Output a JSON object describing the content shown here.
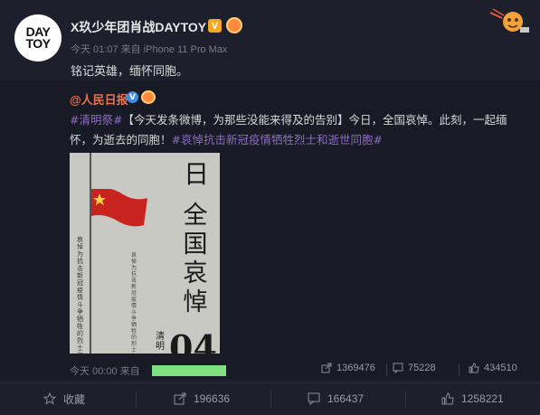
{
  "post": {
    "avatar_text": "DAY TOY",
    "author": "X玖少年团肖战DAYTOY",
    "verified_badge": "V",
    "meta": "今天 01:07 来自 iPhone 11 Pro Max",
    "text": "铭记英雄，缅怀同胞。"
  },
  "repost": {
    "author": "@人民日报",
    "verified_badge": "V",
    "text_hashtag1": "#清明祭#",
    "text_body1": "【今天发条微博，为那些没能来得及的告别】今日，全国哀悼。此刻，一起缅怀，为逝去的同胞！",
    "text_hashtag2": "#哀悼抗击新冠疫情牺牲烈士和逝世同胞#",
    "poster": {
      "top_char": "日",
      "title": "全国哀悼",
      "vertical_text": "哀悼为抗击新冠疫情斗争牺牲的烈士和逝世同胞",
      "qingming": "清明",
      "date": "04"
    },
    "meta": "今天 00:00 来自",
    "stats": {
      "reposts": "1369476",
      "comments": "75228",
      "likes": "434510"
    }
  },
  "actions": {
    "favorite": "收藏",
    "repost": "196636",
    "comment": "166437",
    "like": "1258221"
  },
  "colors": {
    "background": "#1d1f2c",
    "repost_background": "#181a25",
    "hashtag": "#8d6cc4",
    "censor": "#7fe07f"
  }
}
